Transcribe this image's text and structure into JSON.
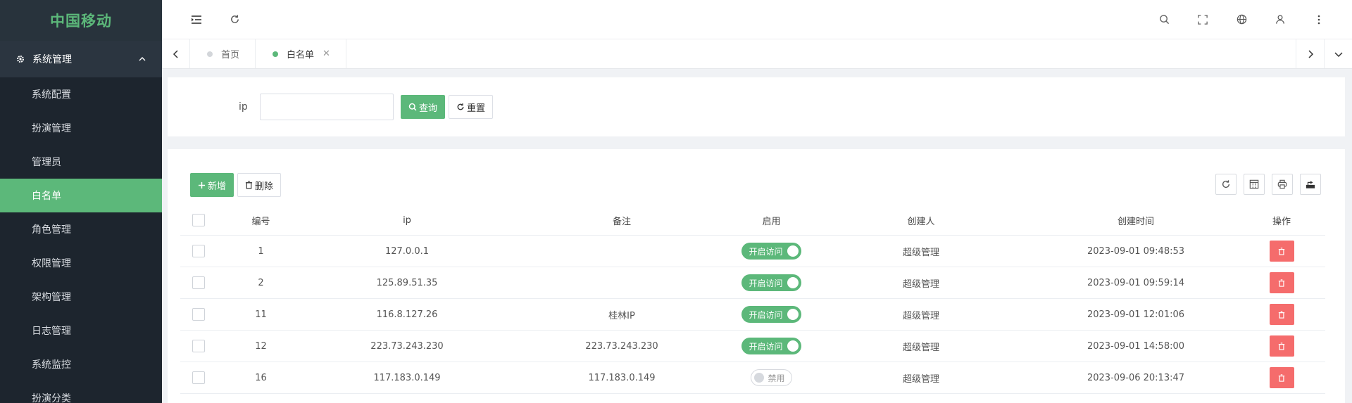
{
  "sidebar": {
    "logo": "中国移动",
    "group_title": "系统管理",
    "items": [
      {
        "label": "系统配置",
        "active": false
      },
      {
        "label": "扮演管理",
        "active": false
      },
      {
        "label": "管理员",
        "active": false
      },
      {
        "label": "白名单",
        "active": true
      },
      {
        "label": "角色管理",
        "active": false
      },
      {
        "label": "权限管理",
        "active": false
      },
      {
        "label": "架构管理",
        "active": false
      },
      {
        "label": "日志管理",
        "active": false
      },
      {
        "label": "系统监控",
        "active": false
      },
      {
        "label": "扮演分类",
        "active": false
      }
    ]
  },
  "header": {
    "left_icons": [
      "menu-toggle-icon",
      "refresh-icon"
    ],
    "right_icons": [
      "search-icon",
      "fullscreen-icon",
      "globe-icon",
      "user-icon",
      "more-icon"
    ]
  },
  "tabs": [
    {
      "label": "首页",
      "active": false
    },
    {
      "label": "白名单",
      "active": true
    }
  ],
  "search": {
    "label": "ip",
    "value": "",
    "placeholder": "",
    "search_button": "查询",
    "reset_button": "重置"
  },
  "toolbar": {
    "add_button": "新增",
    "delete_button": "删除"
  },
  "table": {
    "columns": [
      "编号",
      "ip",
      "备注",
      "启用",
      "创建人",
      "创建时间",
      "操作"
    ],
    "rows": [
      {
        "id": "1",
        "ip": "127.0.0.1",
        "note": "",
        "enabled": true,
        "status": "开启访问",
        "creator": "超级管理",
        "time": "2023-09-01 09:48:53"
      },
      {
        "id": "2",
        "ip": "125.89.51.35",
        "note": "",
        "enabled": true,
        "status": "开启访问",
        "creator": "超级管理",
        "time": "2023-09-01 09:59:14"
      },
      {
        "id": "11",
        "ip": "116.8.127.26",
        "note": "桂林IP",
        "enabled": true,
        "status": "开启访问",
        "creator": "超级管理",
        "time": "2023-09-01 12:01:06"
      },
      {
        "id": "12",
        "ip": "223.73.243.230",
        "note": "223.73.243.230",
        "enabled": true,
        "status": "开启访问",
        "creator": "超级管理",
        "time": "2023-09-01 14:58:00"
      },
      {
        "id": "16",
        "ip": "117.183.0.149",
        "note": "117.183.0.149",
        "enabled": false,
        "status": "禁用",
        "creator": "超级管理",
        "time": "2023-09-06 20:13:47"
      }
    ]
  },
  "colors": {
    "accent": "#5cb87a",
    "sidebar_bg": "#222c35",
    "danger": "#f56c6c"
  }
}
